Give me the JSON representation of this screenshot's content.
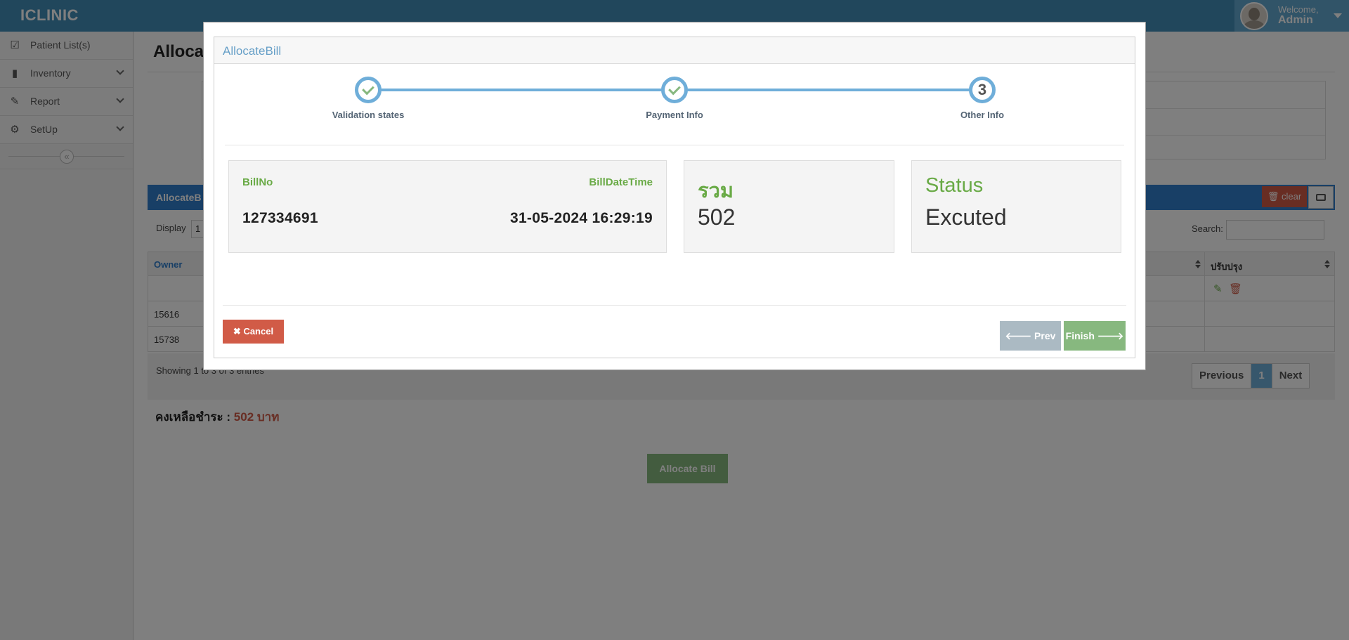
{
  "app": {
    "brand": "ICLINIC",
    "welcome": "Welcome,",
    "user": "Admin"
  },
  "sidebar": {
    "items": [
      {
        "label": "Patient List(s)",
        "icon": "check-square-icon"
      },
      {
        "label": "Inventory",
        "icon": "file-icon"
      },
      {
        "label": "Report",
        "icon": "edit-icon"
      },
      {
        "label": "SetUp",
        "icon": "gear-icon"
      }
    ],
    "collapse_glyph": "«"
  },
  "page": {
    "title": "Alloca",
    "table_title": "AllocateB",
    "clear_label": "clear",
    "display_label": "Display",
    "display_value": "1",
    "search_label": "Search:",
    "columns": {
      "owner": "Owner",
      "update": "ปรับปรุง"
    },
    "rows": [
      {
        "owner": ""
      },
      {
        "owner": "15616"
      },
      {
        "owner": "15738"
      }
    ],
    "showing": "Showing 1 to 3 of 3 entries",
    "pagination": {
      "previous": "Previous",
      "current": "1",
      "next": "Next"
    },
    "balance_label": "คงเหลือชำระ : ",
    "balance_amount": "502 บาท",
    "allocate_button": "Allocate Bill"
  },
  "modal": {
    "title": "AllocateBill",
    "steps": [
      {
        "label": "Validation states",
        "state": "done"
      },
      {
        "label": "Payment Info",
        "state": "done"
      },
      {
        "label": "Other Info",
        "state": "current",
        "number": "3"
      }
    ],
    "bill": {
      "no_label": "BillNo",
      "date_label": "BillDateTime",
      "no_value": "127334691",
      "date_value": "31-05-2024 16:29:19"
    },
    "total": {
      "label": "รวม",
      "value": "502"
    },
    "status": {
      "label": "Status",
      "value": "Excuted"
    },
    "cancel_label": "Cancel",
    "prev_label": "Prev",
    "finish_label": "Finish"
  },
  "colors": {
    "navbar": "#438eb9",
    "accent_green": "#69aa46",
    "danger": "#d15b47",
    "step_blue": "#6faed9"
  }
}
